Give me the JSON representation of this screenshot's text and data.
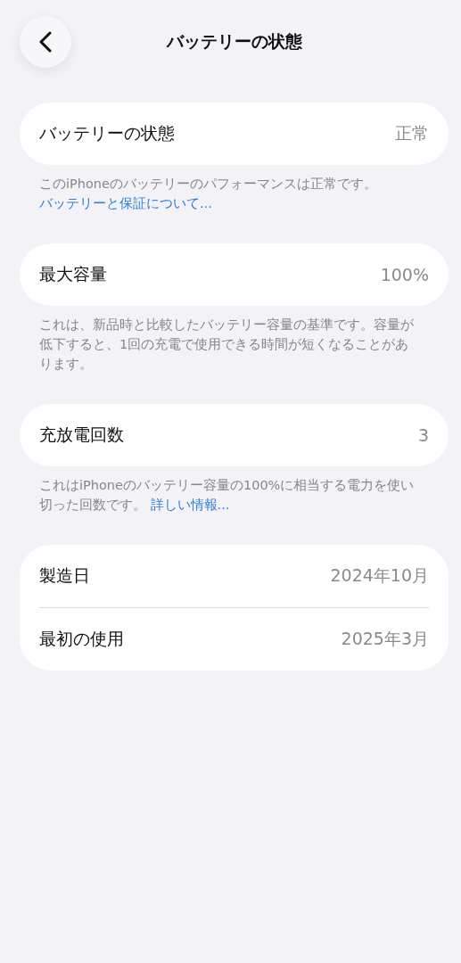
{
  "nav": {
    "title": "バッテリーの状態"
  },
  "sections": [
    {
      "rows": [
        {
          "label": "バッテリーの状態",
          "value": "正常"
        }
      ],
      "footer": {
        "text": "このiPhoneのバッテリーのパフォーマンスは正常です。",
        "link": "バッテリーと保証について..."
      }
    },
    {
      "rows": [
        {
          "label": "最大容量",
          "value": "100%"
        }
      ],
      "footer": {
        "text": "これは、新品時と比較したバッテリー容量の基準です。容量が低下すると、1回の充電で使用できる時間が短くなることがあります。"
      }
    },
    {
      "rows": [
        {
          "label": "充放電回数",
          "value": "3"
        }
      ],
      "footer": {
        "text": "これはiPhoneのバッテリー容量の100%に相当する電力を使い切った回数です。",
        "link": "詳しい情報..."
      }
    },
    {
      "rows": [
        {
          "label": "製造日",
          "value": "2024年10月"
        },
        {
          "label": "最初の使用",
          "value": "2025年3月"
        }
      ]
    }
  ]
}
